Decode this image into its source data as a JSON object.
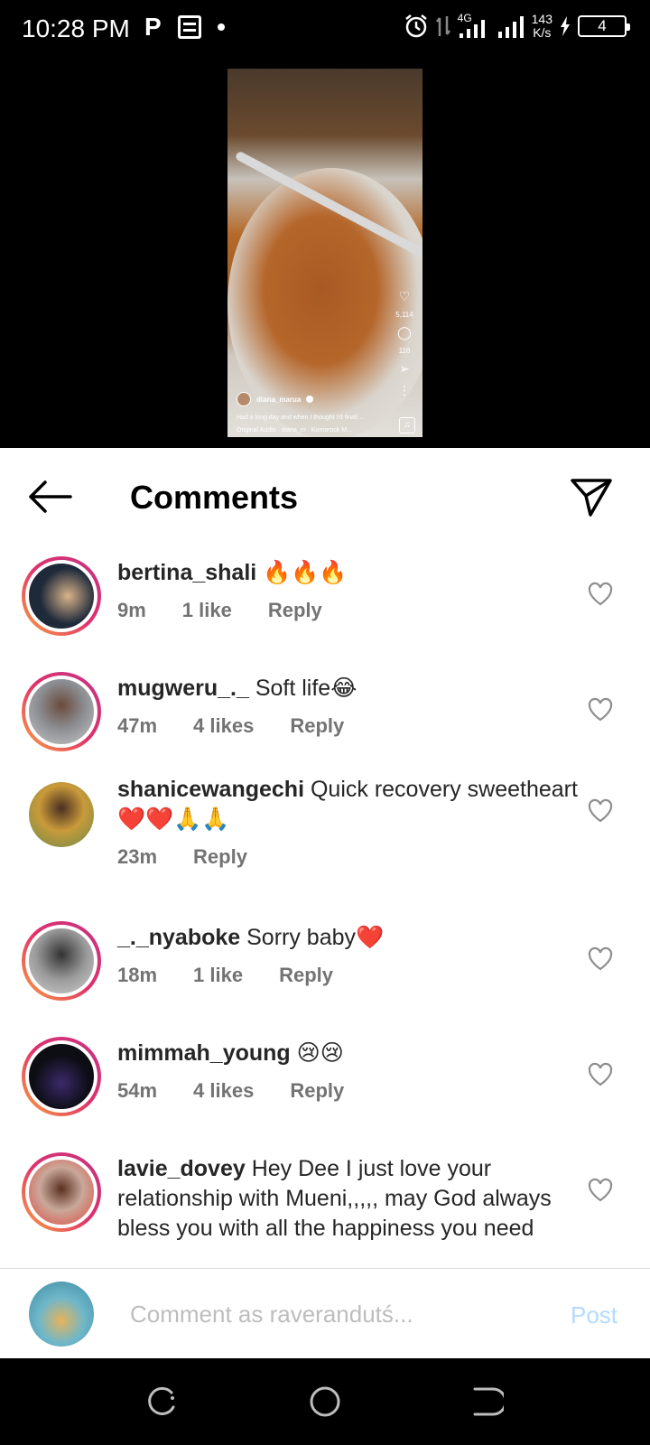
{
  "status_bar": {
    "time": "10:28 PM",
    "p_icon": "P",
    "network": "4G",
    "speed_value": "143",
    "speed_unit": "K/s",
    "battery": "4"
  },
  "video": {
    "likes": "5,114",
    "comments": "116",
    "username": "diana_marua",
    "caption": "Had a long day and when I thought I'd finall ...",
    "audio": "Original Audio · diana_m · Komarock M..."
  },
  "header": {
    "title": "Comments"
  },
  "comments": [
    {
      "user": "bertina_shali",
      "text": " 🔥🔥🔥",
      "time": "9m",
      "likes": "1 like",
      "reply": "Reply",
      "story": true,
      "avatar_color": "#1e2a3a"
    },
    {
      "user": "mugweru_._",
      "text": " Soft life😂",
      "time": "47m",
      "likes": "4 likes",
      "reply": "Reply",
      "story": true,
      "avatar_color": "#8a8c90"
    },
    {
      "user": "shanicewangechi",
      "text": " Quick recovery sweetheart ❤️❤️🙏🙏",
      "time": "23m",
      "likes": "",
      "reply": "Reply",
      "story": false,
      "avatar_color": "#c99a3a"
    },
    {
      "user": "_._nyaboke",
      "text": " Sorry baby❤️",
      "time": "18m",
      "likes": "1 like",
      "reply": "Reply",
      "story": true,
      "avatar_color": "#9a9a9a"
    },
    {
      "user": "mimmah_young",
      "text": " 😢😢",
      "time": "54m",
      "likes": "4 likes",
      "reply": "Reply",
      "story": true,
      "avatar_color": "#0d0d14"
    },
    {
      "user": "lavie_dovey",
      "text": " Hey Dee I just love your relationship with Mueni,,,,, may God always bless you with all the happiness you need",
      "time": "",
      "likes": "",
      "reply": "",
      "story": true,
      "avatar_color": "#c9a89a"
    }
  ],
  "input": {
    "placeholder": "Comment as raverandutś...",
    "post_label": "Post"
  },
  "colors": {
    "story_ring_start": "#f9a53f",
    "story_ring_end": "#c13584",
    "post_disabled": "#b3dbff"
  },
  "icons": {
    "back": "arrow-left-icon",
    "send": "paper-plane-icon",
    "like": "heart-outline-icon",
    "nav_recents": "recents-icon",
    "nav_home": "home-circle-icon",
    "nav_back": "back-nav-icon"
  }
}
